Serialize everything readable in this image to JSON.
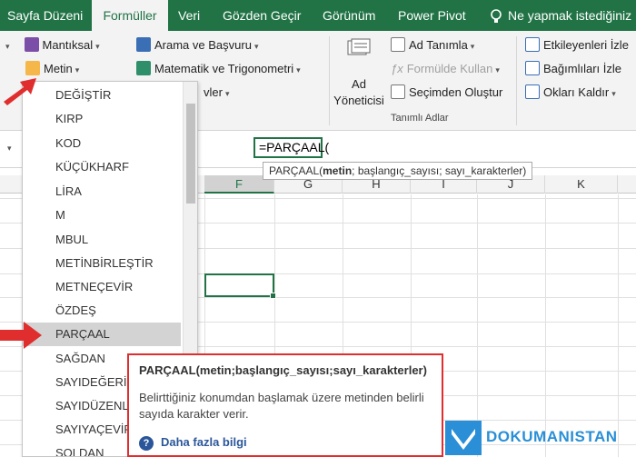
{
  "tabs": [
    "Sayfa Düzeni",
    "Formüller",
    "Veri",
    "Gözden Geçir",
    "Görünüm",
    "Power Pivot"
  ],
  "active_tab": "Formüller",
  "tell_me": "Ne yapmak istediğiniz",
  "ribbon": {
    "logical": "Mantıksal",
    "text": "Metin",
    "lookup": "Arama ve Başvuru",
    "math": "Matematik ve Trigonometri",
    "more_partial": "vler",
    "name_manager_line1": "Ad",
    "name_manager_line2": "Yöneticisi",
    "define_name": "Ad Tanımla",
    "use_in_formula": "Formülde Kullan",
    "create_from_selection": "Seçimden Oluştur",
    "defined_names_group": "Tanımlı Adlar",
    "trace_precedents": "Etkileyenleri İzle",
    "trace_dependents": "Bağımlıları İzle",
    "remove_arrows": "Okları Kaldır"
  },
  "formula": {
    "text": "=PARÇAAL(",
    "tooltip_func": "PARÇAAL(",
    "tooltip_arg_bold": "metin",
    "tooltip_rest": "; başlangıç_sayısı; sayı_karakterler)"
  },
  "columns": [
    "F",
    "G",
    "H",
    "I",
    "J",
    "K"
  ],
  "selected_column": "F",
  "dropdown": {
    "items": [
      "DEĞİŞTİR",
      "KIRP",
      "KOD",
      "KÜÇÜKHARF",
      "LİRA",
      "M",
      "MBUL",
      "METİNBİRLEŞTİR",
      "METNEÇEVİR",
      "ÖZDEŞ",
      "PARÇAAL",
      "SAĞDAN",
      "SAYIDEĞERİ",
      "SAYIDÜZENLE",
      "SAYIYAÇEVİR",
      "SOLDAN"
    ],
    "highlighted": "PARÇAAL"
  },
  "help": {
    "title": "PARÇAAL(metin;başlangıç_sayısı;sayı_karakterler)",
    "description": "Belirttiğiniz konumdan başlamak üzere metinden belirli sayıda karakter verir.",
    "link": "Daha fazla bilgi"
  },
  "watermark": "DOKUMANISTAN",
  "colors": {
    "excel_green": "#217346",
    "highlight_red": "#e02d2d",
    "link_blue": "#2b579a",
    "watermark_blue": "#2a8fd6"
  }
}
